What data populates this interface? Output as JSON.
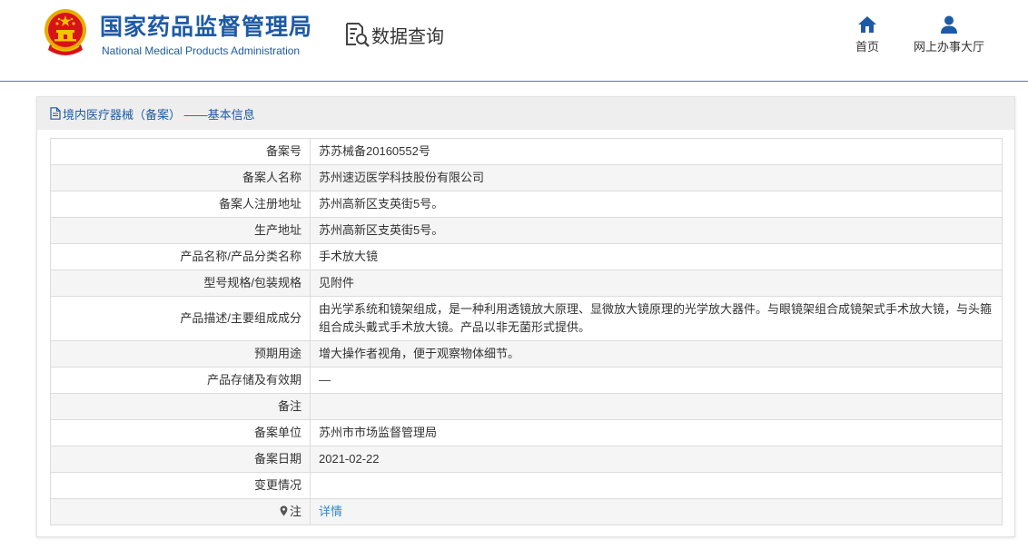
{
  "header": {
    "title": "国家药品监督管理局",
    "subtitle": "National Medical Products Administration",
    "query_label": "数据查询",
    "nav": [
      {
        "label": "首页",
        "icon": "home-icon"
      },
      {
        "label": "网上办事大厅",
        "icon": "user-icon"
      }
    ]
  },
  "panel": {
    "title": "境内医疗器械（备案） ——基本信息",
    "rows": [
      {
        "label": "备案号",
        "value": "苏苏械备20160552号"
      },
      {
        "label": "备案人名称",
        "value": "苏州速迈医学科技股份有限公司"
      },
      {
        "label": "备案人注册地址",
        "value": "苏州高新区支英街5号。"
      },
      {
        "label": "生产地址",
        "value": "苏州高新区支英街5号。"
      },
      {
        "label": "产品名称/产品分类名称",
        "value": "手术放大镜"
      },
      {
        "label": "型号规格/包装规格",
        "value": "见附件"
      },
      {
        "label": "产品描述/主要组成成分",
        "value": "由光学系统和镜架组成，是一种利用透镜放大原理、显微放大镜原理的光学放大器件。与眼镜架组合成镜架式手术放大镜，与头箍组合成头戴式手术放大镜。产品以非无菌形式提供。"
      },
      {
        "label": "预期用途",
        "value": "增大操作者视角，便于观察物体细节。"
      },
      {
        "label": "产品存储及有效期",
        "value": "—"
      },
      {
        "label": "备注",
        "value": ""
      },
      {
        "label": "备案单位",
        "value": "苏州市市场监督管理局"
      },
      {
        "label": "备案日期",
        "value": "2021-02-22"
      },
      {
        "label": "变更情况",
        "value": ""
      },
      {
        "label": "注",
        "value": "详情",
        "icon": "pin-icon"
      }
    ]
  },
  "colors": {
    "brand": "#1d5aa6",
    "link": "#2d87d6",
    "row_alt": "#f5f5f5",
    "grid": "#dcdcdc",
    "header_rule": "#3f7fc1",
    "panel_head": "#eeeeee"
  }
}
